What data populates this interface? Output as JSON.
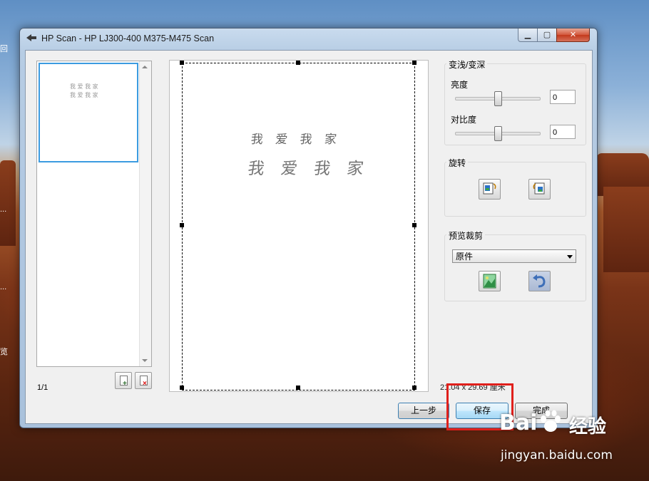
{
  "window": {
    "title": "HP Scan - HP LJ300-400 M375-M475 Scan",
    "close_label": "✕"
  },
  "desktop": {
    "left_fragments": [
      "回",
      "...",
      "...",
      "览"
    ]
  },
  "thumbnails": {
    "page_count": "1/1"
  },
  "preview": {
    "line1": "我 爱 我 家",
    "line2": "我 爱 我 家"
  },
  "adjust": {
    "group_title": "变浅/变深",
    "brightness_label": "亮度",
    "brightness_value": "0",
    "brightness_level": 0.5,
    "contrast_label": "对比度",
    "contrast_value": "0",
    "contrast_level": 0.5
  },
  "rotate": {
    "group_title": "旋转",
    "left_icon": "rotate-left-icon",
    "right_icon": "rotate-right-icon"
  },
  "crop": {
    "group_title": "预览裁剪",
    "selected_option": "原件",
    "crop_icon": "crop-image-icon",
    "undo_icon": "undo-icon"
  },
  "size_text": "21.04 x 29.69 厘米",
  "buttons": {
    "prev": "上一步",
    "save": "保存",
    "done": "完成"
  },
  "watermark": {
    "logo": "Bai",
    "brand_cn": "经验",
    "url": "jingyan.baidu.com"
  },
  "colors": {
    "highlight_red": "#e0201c",
    "thumb_selection": "#3c9be0"
  }
}
